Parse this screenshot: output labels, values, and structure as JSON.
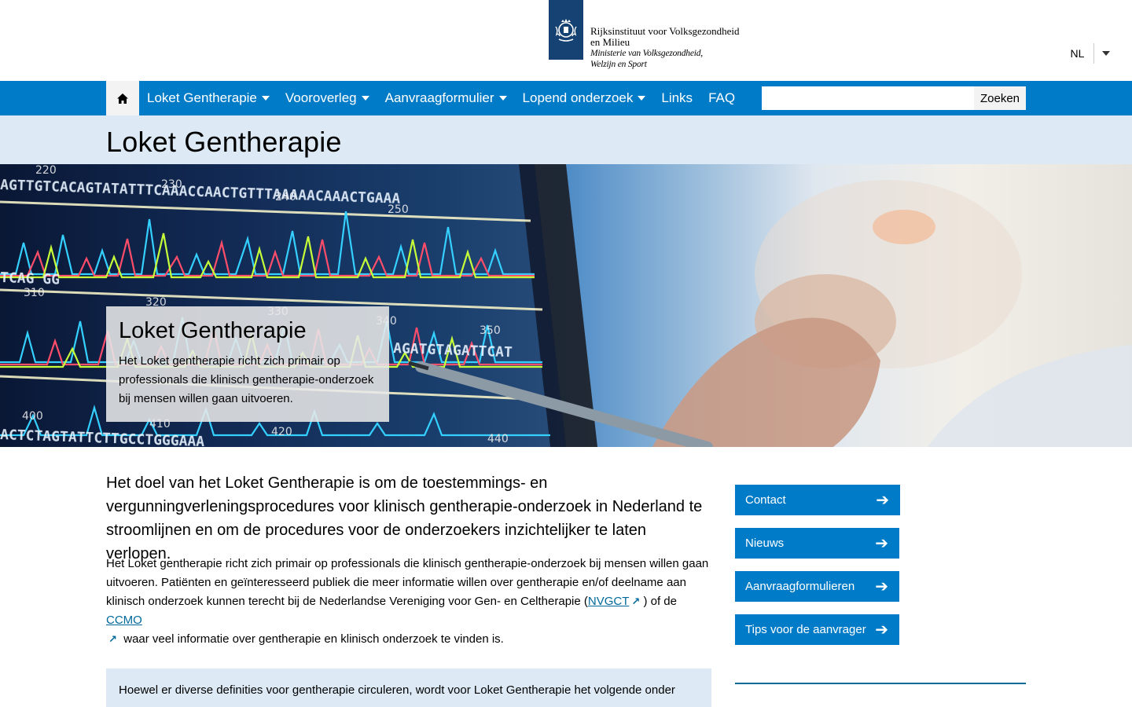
{
  "header": {
    "org_line1": "Rijksinstituut voor Volksgezondheid",
    "org_line2": "en Milieu",
    "ministry_line1": "Ministerie van Volksgezondheid,",
    "ministry_line2": "Welzijn en Sport",
    "language": "NL"
  },
  "nav": {
    "items": [
      {
        "label": "Loket Gentherapie",
        "has_dropdown": true
      },
      {
        "label": "Vooroverleg",
        "has_dropdown": true
      },
      {
        "label": "Aanvraagformulier",
        "has_dropdown": true
      },
      {
        "label": "Lopend onderzoek",
        "has_dropdown": true
      },
      {
        "label": "Links",
        "has_dropdown": false
      },
      {
        "label": "FAQ",
        "has_dropdown": false
      }
    ],
    "search_placeholder": "",
    "search_button": "Zoeken",
    "brand_color": "#007bc7"
  },
  "page": {
    "title": "Loket Gentherapie"
  },
  "hero": {
    "title": "Loket Gentherapie",
    "text": "Het Loket gentherapie richt zich primair op professionals die klinisch gentherapie-onderzoek bij mensen willen gaan uitvoeren."
  },
  "main": {
    "lead": "Het doel van het Loket Gentherapie is om de toestemmings- en vergunningverleningsprocedures voor klinisch gentherapie-onderzoek in Nederland te stroomlijnen en om de procedures voor de onderzoekers inzichtelijker te laten verlopen.",
    "body_part1": "Het Loket gentherapie richt zich primair op professionals die klinisch gentherapie-onderzoek bij mensen willen gaan uitvoeren. Patiënten en geïnteresseerd publiek die meer informatie willen over gentherapie en/of deelname aan klinisch onderzoek kunnen terecht bij de Nederlandse Vereniging voor Gen- en Celtherapie (",
    "link1": "NVGCT",
    "body_part2": ") of de",
    "link2": "CCMO",
    "body_part3": "waar veel informatie over gentherapie en klinisch onderzoek te vinden is.",
    "callout": "Hoewel er diverse definities voor gentherapie circuleren, wordt voor Loket Gentherapie het volgende onder"
  },
  "sidebar": {
    "buttons": [
      {
        "label": "Contact"
      },
      {
        "label": "Nieuws"
      },
      {
        "label": "Aanvraagformulieren"
      },
      {
        "label": "Tips voor de aanvrager"
      }
    ]
  }
}
